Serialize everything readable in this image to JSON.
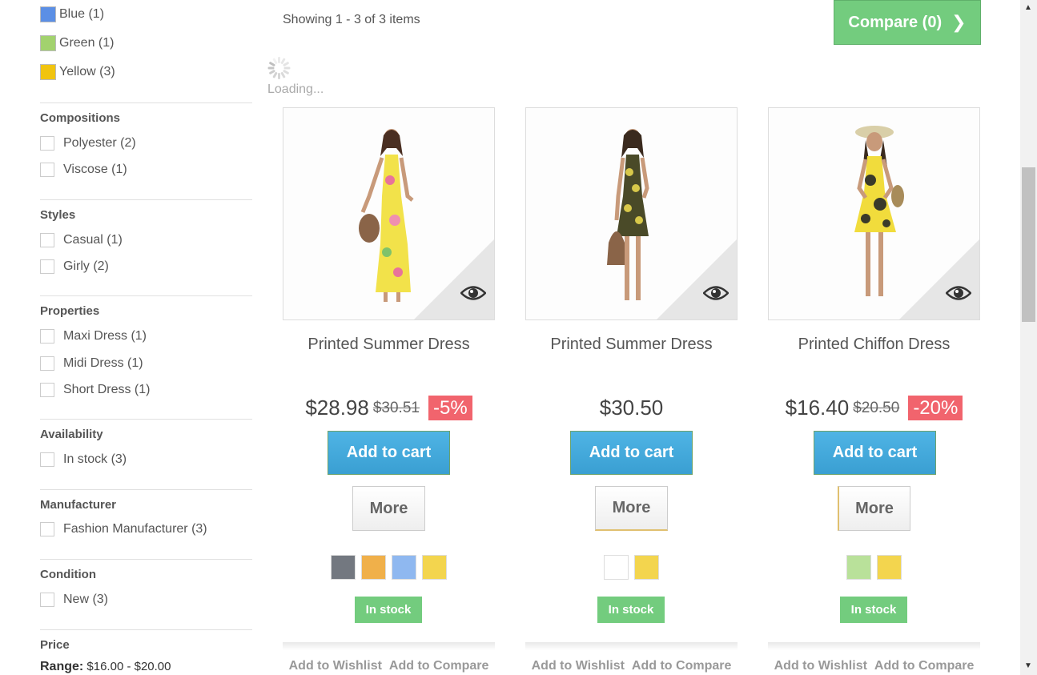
{
  "sidebar": {
    "colors": [
      {
        "label": "Blue (1)",
        "color": "#5b8fe5"
      },
      {
        "label": "Green (1)",
        "color": "#a2d26e"
      },
      {
        "label": "Yellow (3)",
        "color": "#f1c40f"
      }
    ],
    "groups": [
      {
        "title": "Compositions",
        "items": [
          "Polyester (2)",
          "Viscose (1)"
        ]
      },
      {
        "title": "Styles",
        "items": [
          "Casual (1)",
          "Girly (2)"
        ]
      },
      {
        "title": "Properties",
        "items": [
          "Maxi Dress (1)",
          "Midi Dress (1)",
          "Short Dress (1)"
        ]
      },
      {
        "title": "Availability",
        "items": [
          "In stock (3)"
        ]
      },
      {
        "title": "Manufacturer",
        "items": [
          "Fashion Manufacturer (3)"
        ]
      },
      {
        "title": "Condition",
        "items": [
          "New (3)"
        ]
      }
    ],
    "price": {
      "title": "Price",
      "range_label": "Range:",
      "range_value": "$16.00 - $20.00"
    }
  },
  "toolbar": {
    "showing": "Showing 1 - 3 of 3 items",
    "compare_label": "Compare (0)",
    "loading": "Loading..."
  },
  "products": [
    {
      "name": "Printed Summer Dress",
      "price": "$28.98",
      "old_price": "$30.51",
      "discount": "-5%",
      "add_to_cart": "Add to cart",
      "more": "More",
      "swatches": [
        "#737880",
        "#f0b04a",
        "#8fb8f0",
        "#f3d54e"
      ],
      "stock": "In stock",
      "wishlist": "Add to Wishlist",
      "compare": "Add to Compare",
      "image_icon": "dress-long-photo"
    },
    {
      "name": "Printed Summer Dress",
      "price": "$30.50",
      "old_price": "",
      "discount": "",
      "add_to_cart": "Add to cart",
      "more": "More",
      "swatches": [
        "#ffffff",
        "#f3d54e"
      ],
      "stock": "In stock",
      "wishlist": "Add to Wishlist",
      "compare": "Add to Compare",
      "image_icon": "dress-short-photo"
    },
    {
      "name": "Printed Chiffon Dress",
      "price": "$16.40",
      "old_price": "$20.50",
      "discount": "-20%",
      "add_to_cart": "Add to cart",
      "more": "More",
      "swatches": [
        "#b9e19a",
        "#f3d54e"
      ],
      "stock": "In stock",
      "wishlist": "Add to Wishlist",
      "compare": "Add to Compare",
      "image_icon": "dress-chiffon-photo"
    }
  ],
  "colors": {
    "accent_green": "#73cc7e",
    "cart_blue": "#3a9fd2",
    "discount_red": "#f1646d"
  }
}
